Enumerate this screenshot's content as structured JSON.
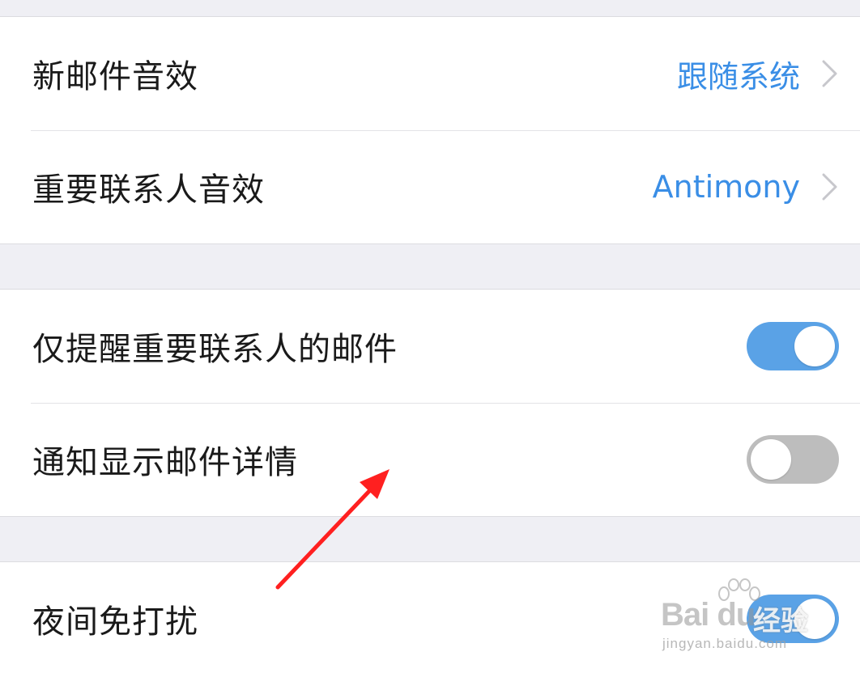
{
  "groups": [
    {
      "rows": [
        {
          "label": "新邮件音效",
          "value": "跟随系统",
          "control": "chevron"
        },
        {
          "label": "重要联系人音效",
          "value": "Antimony",
          "control": "chevron"
        }
      ]
    },
    {
      "rows": [
        {
          "label": "仅提醒重要联系人的邮件",
          "control": "toggle",
          "state": "on"
        },
        {
          "label": "通知显示邮件详情",
          "control": "toggle",
          "state": "off"
        }
      ]
    },
    {
      "rows": [
        {
          "label": "夜间免打扰",
          "control": "toggle",
          "state": "on"
        }
      ]
    }
  ],
  "watermark": {
    "logo_text": "Bai du",
    "site_text": "经验",
    "url": "jingyan.baidu.com"
  },
  "colors": {
    "background": "#efeff4",
    "accent_value": "#3a8ee6",
    "toggle_on": "#5aa2e6",
    "toggle_off": "#bdbdbd",
    "annotation_arrow": "#ff2020"
  },
  "icons": {
    "chevron": "chevron-right-icon",
    "annotation": "red-arrow-annotation"
  }
}
